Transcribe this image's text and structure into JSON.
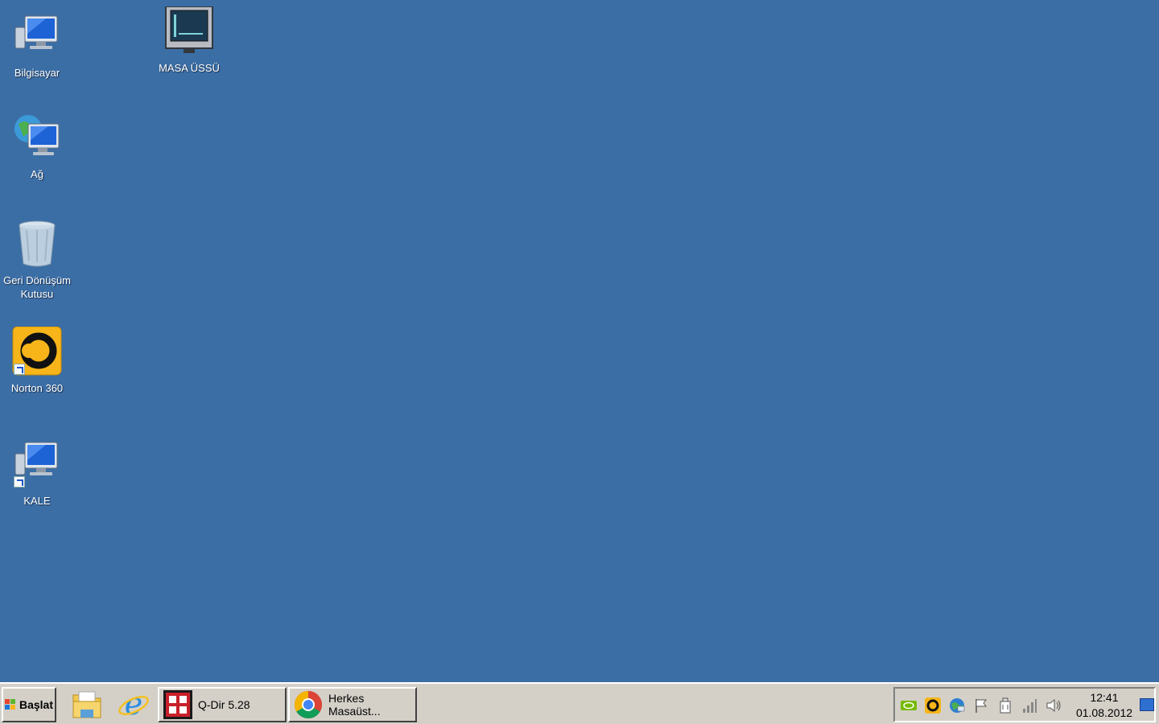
{
  "desktop": {
    "icons": [
      {
        "label": "Bilgisayar",
        "icon": "computer-icon"
      },
      {
        "label": "MASA ÜSSÜ",
        "icon": "monitor-icon"
      },
      {
        "label": "Ağ",
        "icon": "network-icon"
      },
      {
        "label": "Geri Dönüşüm Kutusu",
        "icon": "recycle-bin-icon"
      },
      {
        "label": "Norton 360",
        "icon": "norton-icon"
      },
      {
        "label": "KALE",
        "icon": "computer-shortcut-icon"
      }
    ]
  },
  "taskbar": {
    "start_label": "Başlat",
    "quick_launch": [
      {
        "name": "windows-explorer-icon"
      },
      {
        "name": "internet-explorer-icon"
      }
    ],
    "tasks": [
      {
        "label": "Q-Dir 5.28",
        "icon": "qdir-icon"
      },
      {
        "label": "Herkes Masaüst...",
        "icon": "chrome-icon"
      }
    ],
    "tray": {
      "icons": [
        "nvidia-icon",
        "norton-tray-icon",
        "network-globe-icon",
        "action-center-flag-icon",
        "safely-remove-icon",
        "signal-icon",
        "volume-icon"
      ],
      "time": "12:41",
      "date": "01.08.2012"
    }
  },
  "colors": {
    "desktop_bg": "#3b6ea5",
    "taskbar_bg": "#d4d0c8"
  }
}
